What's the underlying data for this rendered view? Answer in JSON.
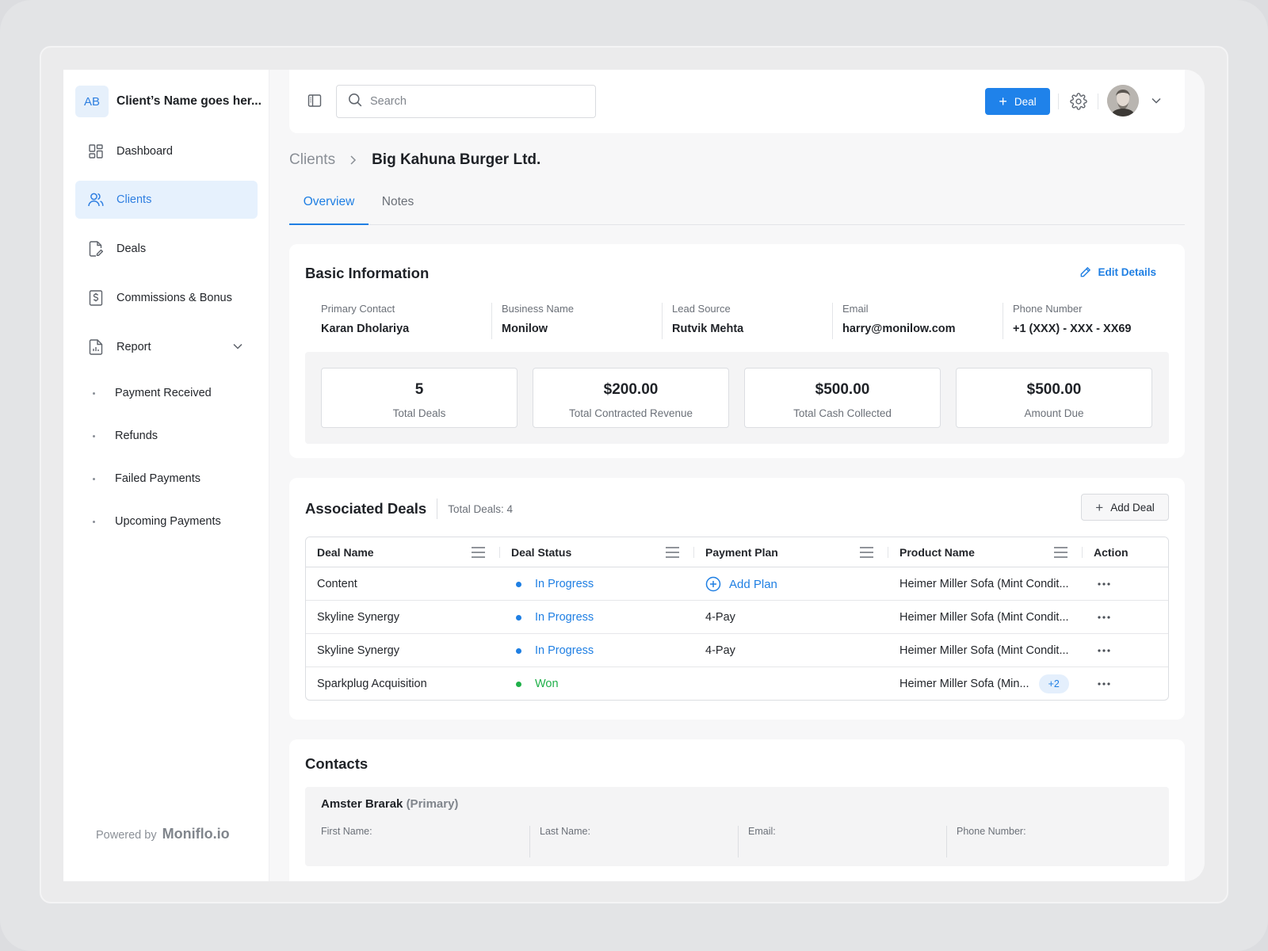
{
  "sidebar": {
    "client_initials": "AB",
    "client_name": "Client’s Name goes her...",
    "nav": [
      {
        "label": "Dashboard",
        "icon": "dashboard-icon"
      },
      {
        "label": "Clients",
        "icon": "users-icon",
        "active": true
      },
      {
        "label": "Deals",
        "icon": "document-edit-icon"
      },
      {
        "label": "Commissions & Bonus",
        "icon": "dollar-receipt-icon"
      },
      {
        "label": "Report",
        "icon": "report-icon"
      }
    ],
    "report_sub": [
      "Payment Received",
      "Refunds",
      "Failed Payments",
      "Upcoming Payments"
    ],
    "powered_prefix": "Powered by",
    "powered_brand": "Moniflo.io"
  },
  "topbar": {
    "search_placeholder": "Search",
    "deal_button": "Deal"
  },
  "breadcrumb": {
    "root": "Clients",
    "current": "Big Kahuna Burger Ltd."
  },
  "tabs": [
    {
      "label": "Overview",
      "active": true
    },
    {
      "label": "Notes"
    }
  ],
  "basic_info": {
    "title": "Basic Information",
    "edit_label": "Edit Details",
    "fields": [
      {
        "label": "Primary Contact",
        "value": "Karan Dholariya"
      },
      {
        "label": "Business Name",
        "value": "Monilow"
      },
      {
        "label": "Lead Source",
        "value": "Rutvik Mehta"
      },
      {
        "label": "Email",
        "value": "harry@monilow.com"
      },
      {
        "label": "Phone Number",
        "value": "+1 (XXX) - XXX - XX69"
      }
    ],
    "stats": [
      {
        "value": "5",
        "label": "Total Deals"
      },
      {
        "value": "$200.00",
        "label": "Total Contracted Revenue"
      },
      {
        "value": "$500.00",
        "label": "Total Cash Collected"
      },
      {
        "value": "$500.00",
        "label": "Amount Due"
      }
    ]
  },
  "deals": {
    "title": "Associated Deals",
    "count_label": "Total Deals: 4",
    "add_label": "Add Deal",
    "columns": [
      "Deal Name",
      "Deal Status",
      "Payment Plan",
      "Product Name",
      "Action"
    ],
    "rows": [
      {
        "name": "Content",
        "status": "In Progress",
        "status_kind": "progress",
        "plan": "Add Plan",
        "plan_is_action": true,
        "product": "Heimer Miller Sofa (Mint Condit...",
        "extra": ""
      },
      {
        "name": "Skyline Synergy",
        "status": "In Progress",
        "status_kind": "progress",
        "plan": "4-Pay",
        "plan_is_action": false,
        "product": "Heimer Miller Sofa (Mint Condit...",
        "extra": ""
      },
      {
        "name": "Skyline Synergy",
        "status": "In Progress",
        "status_kind": "progress",
        "plan": "4-Pay",
        "plan_is_action": false,
        "product": "Heimer Miller Sofa (Mint Condit...",
        "extra": ""
      },
      {
        "name": "Sparkplug Acquisition",
        "status": "Won",
        "status_kind": "won",
        "plan": "",
        "plan_is_action": false,
        "product": "Heimer Miller Sofa (Min...",
        "extra": "+2"
      }
    ],
    "colors": {
      "progress": "#1f7fe3",
      "won": "#20b04a"
    }
  },
  "contacts": {
    "title": "Contacts",
    "primary_name": "Amster Brarak",
    "primary_tag": "(Primary)",
    "fields": [
      {
        "label": "First Name:"
      },
      {
        "label": "Last Name:"
      },
      {
        "label": "Email:"
      },
      {
        "label": "Phone Number:"
      }
    ]
  },
  "colors": {
    "accent": "#1f82ea",
    "active_nav_bg": "#e6f1fd"
  }
}
